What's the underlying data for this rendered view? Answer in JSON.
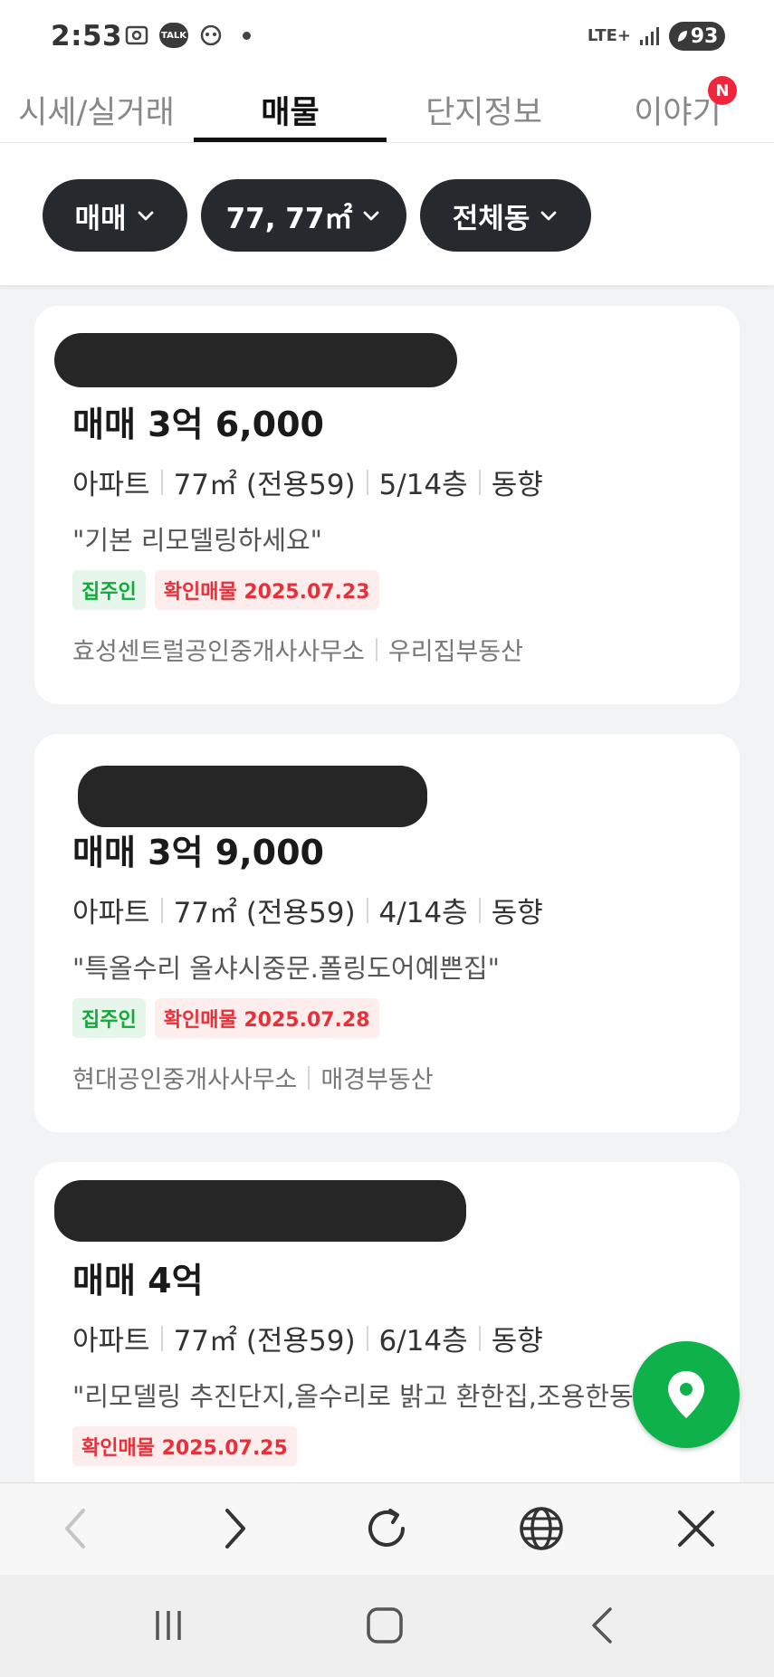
{
  "status_bar": {
    "time": "2:53",
    "talk_label": "TALK",
    "network": "LTE+",
    "battery": "93"
  },
  "tabs": [
    {
      "label": "시세/실거래",
      "active": false
    },
    {
      "label": "매물",
      "active": true
    },
    {
      "label": "단지정보",
      "active": false
    },
    {
      "label": "이야기",
      "active": false,
      "badge": "N"
    }
  ],
  "filters": [
    {
      "label": "매매"
    },
    {
      "label": "77, 77㎡"
    },
    {
      "label": "전체동"
    }
  ],
  "listings": [
    {
      "price": "매매 3억 6,000",
      "type": "아파트",
      "area": "77㎡ (전용59)",
      "floor": "5/14층",
      "direction": "동향",
      "description": "\"기본 리모델링하세요\"",
      "tags": [
        "집주인",
        "확인매물 2025.07.23"
      ],
      "agents": [
        "효성센트럴공인중개사사무소",
        "우리집부동산"
      ]
    },
    {
      "price": "매매 3억 9,000",
      "type": "아파트",
      "area": "77㎡ (전용59)",
      "floor": "4/14층",
      "direction": "동향",
      "description": "\"특올수리 올샤시중문.폴링도어예쁜집\"",
      "tags": [
        "집주인",
        "확인매물 2025.07.28"
      ],
      "agents": [
        "현대공인중개사사무소",
        "매경부동산"
      ]
    },
    {
      "price": "매매 4억",
      "type": "아파트",
      "area": "77㎡ (전용59)",
      "floor": "6/14층",
      "direction": "동향",
      "description": "\"리모델링 추진단지,올수리로 밝고 환한집,조용한동",
      "tags": [
        "확인매물 2025.07.25"
      ],
      "agents": []
    }
  ],
  "colors": {
    "accent_green": "#0fb24a",
    "chip_dark": "#262a2e",
    "verified_red": "#e8303a",
    "owner_green": "#12a83c",
    "badge_red": "#f0243b"
  },
  "icons": {
    "fab": "map-pin-icon",
    "browser": [
      "back-arrow-icon",
      "forward-arrow-icon",
      "refresh-icon",
      "globe-icon",
      "close-icon"
    ],
    "system_nav": [
      "recents-icon",
      "home-icon",
      "back-icon"
    ]
  }
}
